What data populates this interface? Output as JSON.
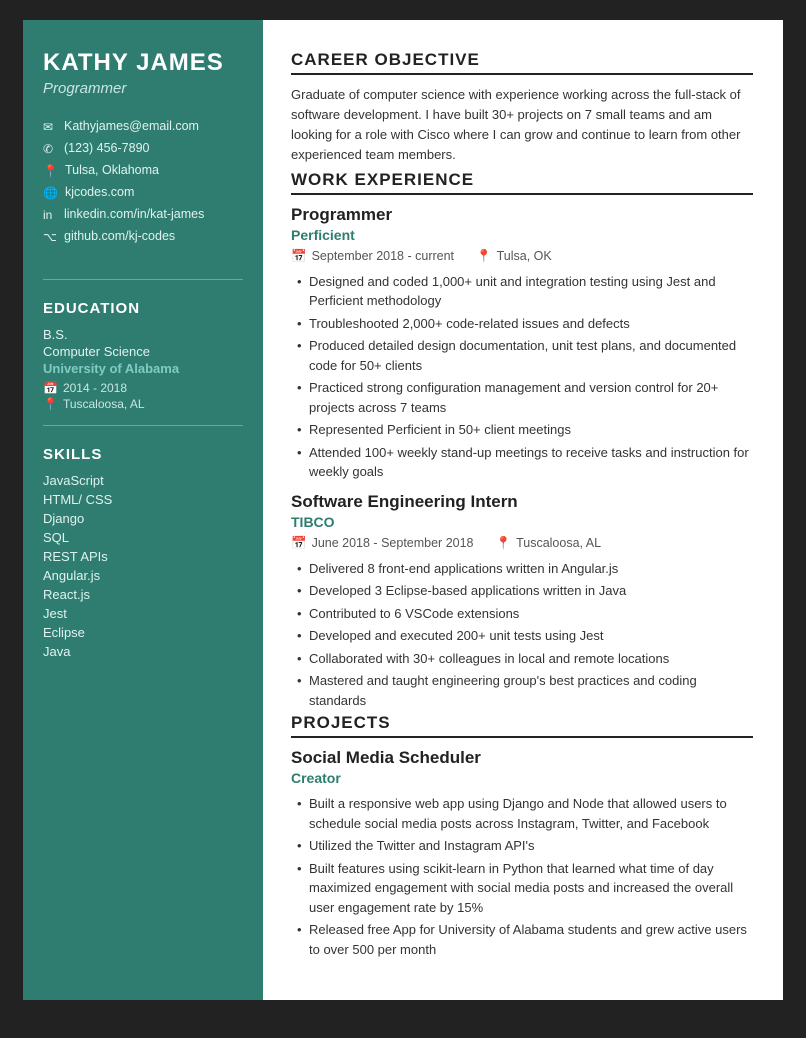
{
  "sidebar": {
    "name": "KATHY JAMES",
    "title": "Programmer",
    "contact": [
      {
        "icon": "envelope",
        "text": "Kathyjames@email.com"
      },
      {
        "icon": "phone",
        "text": "(123) 456-7890"
      },
      {
        "icon": "location",
        "text": "Tulsa, Oklahoma"
      },
      {
        "icon": "globe",
        "text": "kjcodes.com"
      },
      {
        "icon": "linkedin",
        "text": "linkedin.com/in/kat-james"
      },
      {
        "icon": "github",
        "text": "github.com/kj-codes"
      }
    ],
    "education": {
      "section_title": "EDUCATION",
      "degree": "B.S.",
      "major": "Computer Science",
      "school": "University of Alabama",
      "years": "2014 - 2018",
      "location": "Tuscaloosa, AL"
    },
    "skills": {
      "section_title": "SKILLS",
      "items": [
        "JavaScript",
        "HTML/ CSS",
        "Django",
        "SQL",
        "REST APIs",
        "Angular.js",
        "React.js",
        "Jest",
        "Eclipse",
        "Java"
      ]
    }
  },
  "main": {
    "career_objective": {
      "title": "CAREER OBJECTIVE",
      "text": "Graduate of computer science with experience working across the full-stack of software development. I have built 30+ projects on 7 small teams and am looking for a role with Cisco where I can grow and continue to learn from other experienced team members."
    },
    "work_experience": {
      "title": "WORK EXPERIENCE",
      "jobs": [
        {
          "job_title": "Programmer",
          "company": "Perficient",
          "date_range": "September 2018 - current",
          "location": "Tulsa, OK",
          "bullets": [
            "Designed and coded 1,000+ unit and integration testing using Jest and Perficient methodology",
            "Troubleshooted 2,000+ code-related issues and defects",
            "Produced detailed design documentation, unit test plans, and documented code for 50+ clients",
            "Practiced strong configuration management and version control for 20+ projects across 7 teams",
            "Represented Perficient in 50+ client meetings",
            "Attended 100+ weekly stand-up meetings to receive tasks and instruction for weekly goals"
          ]
        },
        {
          "job_title": "Software Engineering Intern",
          "company": "TIBCO",
          "date_range": "June 2018 - September 2018",
          "location": "Tuscaloosa, AL",
          "bullets": [
            "Delivered 8 front-end applications written in Angular.js",
            "Developed 3 Eclipse-based applications written in Java",
            "Contributed to 6 VSCode extensions",
            "Developed and executed 200+ unit tests using Jest",
            "Collaborated with 30+ colleagues in local and remote locations",
            "Mastered and taught engineering group's best practices and coding standards"
          ]
        }
      ]
    },
    "projects": {
      "title": "PROJECTS",
      "items": [
        {
          "project_title": "Social Media Scheduler",
          "role": "Creator",
          "bullets": [
            "Built a responsive web app using Django and Node that allowed users to schedule social media posts across Instagram, Twitter, and Facebook",
            "Utilized the Twitter and Instagram API's",
            "Built features using scikit-learn in Python that learned what time of day maximized engagement with social media posts and increased the overall user engagement rate by 15%",
            "Released free App for University of Alabama students and grew active users to over 500 per month"
          ]
        }
      ]
    }
  },
  "colors": {
    "sidebar_bg": "#2e7d70",
    "accent": "#2e7d70",
    "text_light": "#e0f2ef",
    "text_main": "#222"
  }
}
